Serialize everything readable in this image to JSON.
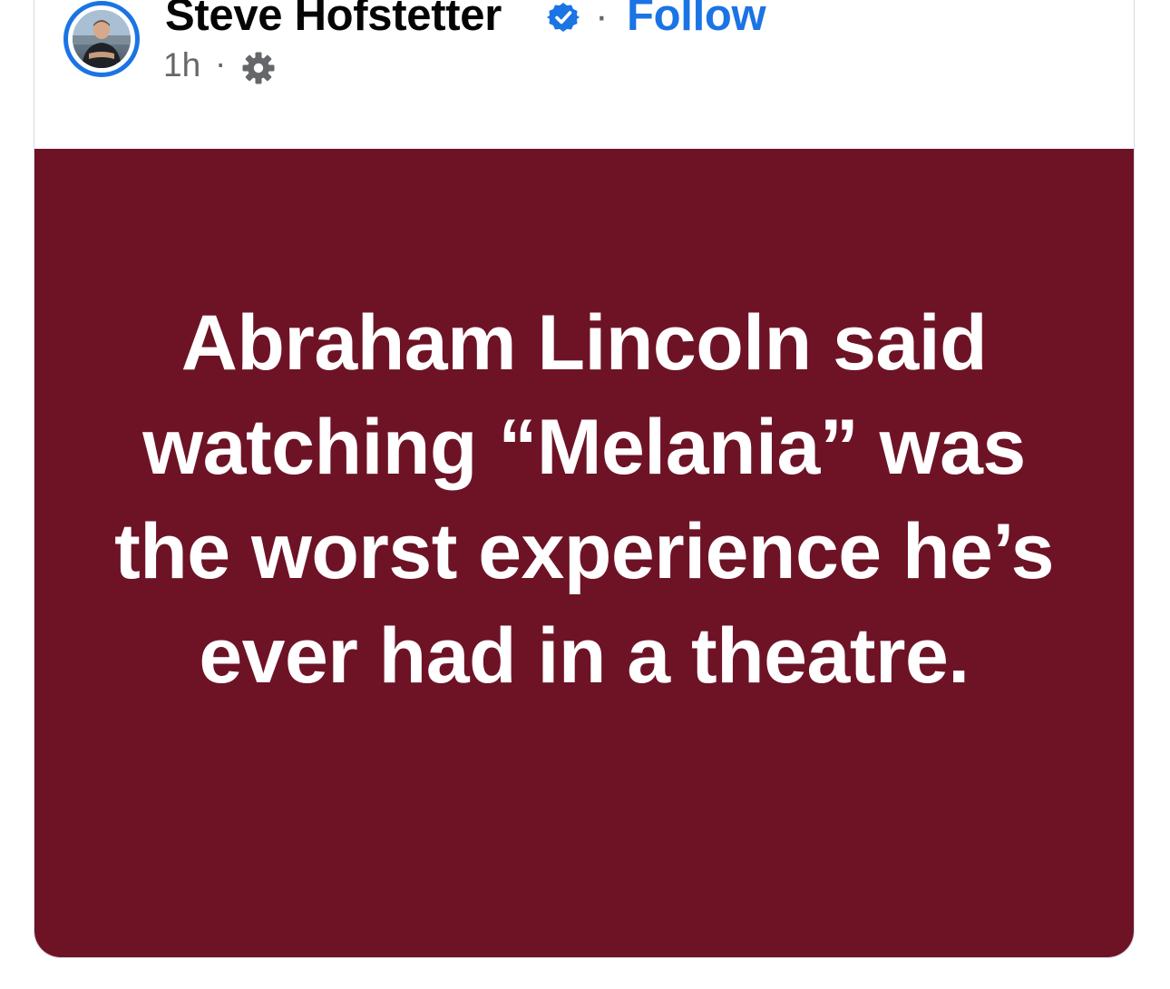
{
  "post": {
    "author": {
      "name": "Steve Hofstetter",
      "verified": true,
      "avatar": "profile-photo"
    },
    "follow_label": "Follow",
    "separator": "·",
    "timestamp": "1h",
    "meta_separator": "·",
    "audience_icon": "gear-icon",
    "content": {
      "text": "Abraham Lincoln said watching “Melania” was the worst experience he’s ever had in a theatre.",
      "background_color": "#6e1326",
      "text_color": "#ffffff"
    }
  },
  "colors": {
    "accent": "#1b74e4",
    "secondary_text": "#65676b",
    "primary_text": "#050505"
  }
}
